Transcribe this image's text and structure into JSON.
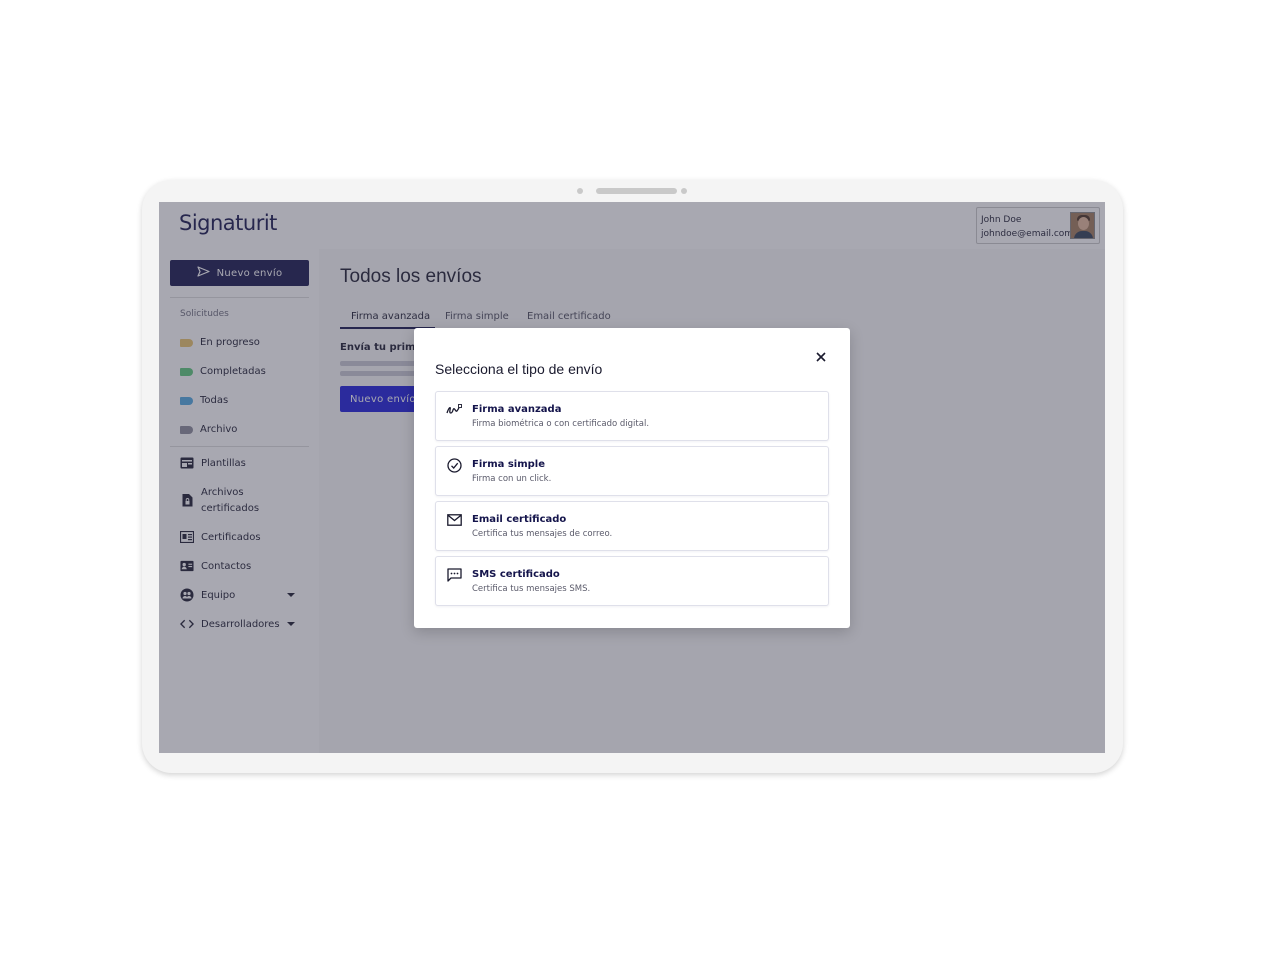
{
  "app": {
    "logo": "Signaturit"
  },
  "user": {
    "name": "John Doe",
    "email": "johndoe@email.com"
  },
  "sidebar": {
    "new_button": "Nuevo envío",
    "section_label": "Solicitudes",
    "requests": [
      {
        "label": "En progreso",
        "color": "#e9c46a"
      },
      {
        "label": "Completadas",
        "color": "#5cc97a"
      },
      {
        "label": "Todas",
        "color": "#4fa8e0"
      },
      {
        "label": "Archivo",
        "color": "#8a8a9a"
      }
    ],
    "tools": [
      {
        "label": "Plantillas",
        "icon": "template-icon"
      },
      {
        "label": "Archivos",
        "label2": "certificados",
        "icon": "lock-file-icon"
      },
      {
        "label": "Certificados",
        "icon": "certificate-icon"
      },
      {
        "label": "Contactos",
        "icon": "contacts-icon"
      },
      {
        "label": "Equipo",
        "icon": "team-icon"
      },
      {
        "label": "Desarrolladores",
        "icon": "code-icon"
      }
    ]
  },
  "main": {
    "title": "Todos los envíos",
    "tabs": [
      "Firma avanzada",
      "Firma simple",
      "Email certificado"
    ],
    "empty_title": "Envía tu primer",
    "button": "Nuevo envío"
  },
  "modal": {
    "title": "Selecciona el tipo de envío",
    "options": [
      {
        "title": "Firma avanzada",
        "desc": "Firma biométrica o con certificado digital.",
        "icon": "signature-icon"
      },
      {
        "title": "Firma simple",
        "desc": "Firma con un click.",
        "icon": "check-circle-icon"
      },
      {
        "title": "Email certificado",
        "desc": "Certifica tus mensajes de correo.",
        "icon": "envelope-icon"
      },
      {
        "title": "SMS certificado",
        "desc": "Certifica tus mensajes SMS.",
        "icon": "chat-icon"
      }
    ]
  }
}
